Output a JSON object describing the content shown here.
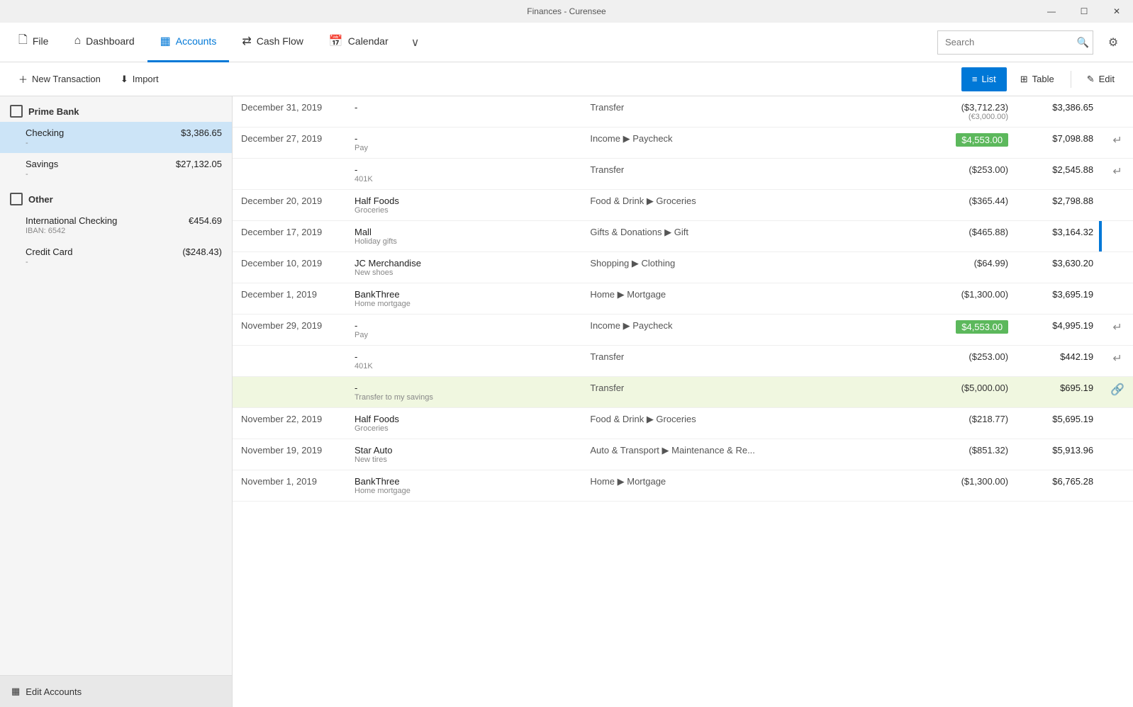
{
  "app": {
    "title": "Finances - Curensee"
  },
  "titlebar": {
    "minimize": "—",
    "maximize": "☐",
    "close": "✕"
  },
  "nav": {
    "file_label": "File",
    "dashboard_label": "Dashboard",
    "accounts_label": "Accounts",
    "cashflow_label": "Cash Flow",
    "calendar_label": "Calendar",
    "more_icon": "∨",
    "search_placeholder": "Search",
    "gear_icon": "⚙"
  },
  "toolbar": {
    "new_transaction_label": "New Transaction",
    "import_label": "Import",
    "list_label": "List",
    "table_label": "Table",
    "edit_label": "Edit"
  },
  "sidebar": {
    "groups": [
      {
        "name": "Prime Bank",
        "accounts": [
          {
            "name": "Checking",
            "sub": "-",
            "balance": "$3,386.65",
            "selected": true
          },
          {
            "name": "Savings",
            "sub": "-",
            "balance": "$27,132.05",
            "selected": false
          }
        ]
      },
      {
        "name": "Other",
        "accounts": [
          {
            "name": "International Checking",
            "sub": "IBAN: 6542",
            "balance": "€454.69",
            "selected": false
          },
          {
            "name": "Credit Card",
            "sub": "-",
            "balance": "($248.43)",
            "selected": false
          }
        ]
      }
    ],
    "edit_accounts_label": "Edit Accounts"
  },
  "transactions": [
    {
      "date": "December 31, 2019",
      "payee_main": "-",
      "payee_sub": "-",
      "category": "Transfer",
      "amount": "($3,712.23)",
      "amount_sub": "(€3,000.00)",
      "balance": "$3,386.65",
      "is_income": false,
      "action": "",
      "highlighted": false,
      "has_bar": false
    },
    {
      "date": "December 27, 2019",
      "payee_main": "-",
      "payee_sub": "Pay",
      "category": "Income ▶ Paycheck",
      "amount": "$4,553.00",
      "balance": "$7,098.88",
      "is_income": true,
      "action": "↵",
      "highlighted": false,
      "has_bar": false
    },
    {
      "date": "",
      "payee_main": "-",
      "payee_sub": "401K",
      "category": "Transfer",
      "amount": "($253.00)",
      "balance": "$2,545.88",
      "is_income": false,
      "action": "↵",
      "highlighted": false,
      "has_bar": false
    },
    {
      "date": "December 20, 2019",
      "payee_main": "Half Foods",
      "payee_sub": "Groceries",
      "category": "Food & Drink ▶ Groceries",
      "amount": "($365.44)",
      "balance": "$2,798.88",
      "is_income": false,
      "action": "",
      "highlighted": false,
      "has_bar": false
    },
    {
      "date": "December 17, 2019",
      "payee_main": "Mall",
      "payee_sub": "Holiday gifts",
      "category": "Gifts & Donations ▶ Gift",
      "amount": "($465.88)",
      "balance": "$3,164.32",
      "is_income": false,
      "action": "",
      "highlighted": false,
      "has_bar": true
    },
    {
      "date": "December 10, 2019",
      "payee_main": "JC Merchandise",
      "payee_sub": "New shoes",
      "category": "Shopping ▶ Clothing",
      "amount": "($64.99)",
      "balance": "$3,630.20",
      "is_income": false,
      "action": "",
      "highlighted": false,
      "has_bar": false
    },
    {
      "date": "December 1, 2019",
      "payee_main": "BankThree",
      "payee_sub": "Home mortgage",
      "category": "Home ▶ Mortgage",
      "amount": "($1,300.00)",
      "balance": "$3,695.19",
      "is_income": false,
      "action": "",
      "highlighted": false,
      "has_bar": false
    },
    {
      "date": "November 29, 2019",
      "payee_main": "-",
      "payee_sub": "Pay",
      "category": "Income ▶ Paycheck",
      "amount": "$4,553.00",
      "balance": "$4,995.19",
      "is_income": true,
      "action": "↵",
      "highlighted": false,
      "has_bar": false
    },
    {
      "date": "",
      "payee_main": "-",
      "payee_sub": "401K",
      "category": "Transfer",
      "amount": "($253.00)",
      "balance": "$442.19",
      "is_income": false,
      "action": "↵",
      "highlighted": false,
      "has_bar": false
    },
    {
      "date": "",
      "payee_main": "-",
      "payee_sub": "Transfer to my savings",
      "category": "Transfer",
      "amount": "($5,000.00)",
      "balance": "$695.19",
      "is_income": false,
      "action": "🔗",
      "highlighted": true,
      "has_bar": false
    },
    {
      "date": "November 22, 2019",
      "payee_main": "Half Foods",
      "payee_sub": "Groceries",
      "category": "Food & Drink ▶ Groceries",
      "amount": "($218.77)",
      "balance": "$5,695.19",
      "is_income": false,
      "action": "",
      "highlighted": false,
      "has_bar": false
    },
    {
      "date": "November 19, 2019",
      "payee_main": "Star Auto",
      "payee_sub": "New tires",
      "category": "Auto & Transport ▶ Maintenance & Re...",
      "amount": "($851.32)",
      "balance": "$5,913.96",
      "is_income": false,
      "action": "",
      "highlighted": false,
      "has_bar": false
    },
    {
      "date": "November 1, 2019",
      "payee_main": "BankThree",
      "payee_sub": "Home mortgage",
      "category": "Home ▶ Mortgage",
      "amount": "($1,300.00)",
      "balance": "$6,765.28",
      "is_income": false,
      "action": "",
      "highlighted": false,
      "has_bar": false
    }
  ]
}
